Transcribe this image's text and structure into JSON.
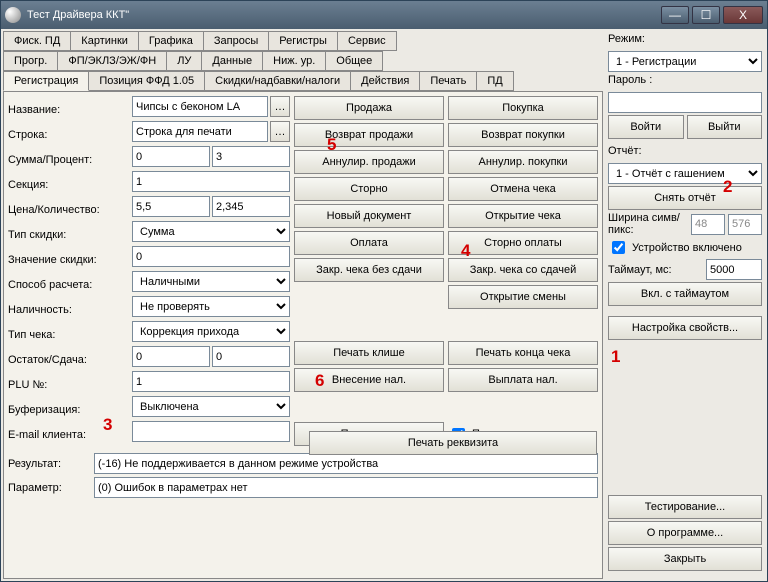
{
  "window": {
    "title": "Тест Драйвера ККТ\""
  },
  "winbtns": {
    "min": "—",
    "max": "☐",
    "close": "X"
  },
  "tabs_row1": [
    "Фиск. ПД",
    "Картинки",
    "Графика",
    "Запросы",
    "Регистры",
    "Сервис"
  ],
  "tabs_row2": [
    "Прогр.",
    "ФП/ЭКЛЗ/ЭЖ/ФН",
    "ЛУ",
    "Данные",
    "Ниж. ур.",
    "Общее"
  ],
  "tabs_row3": [
    "Регистрация",
    "Позиция ФФД 1.05",
    "Скидки/надбавки/налоги",
    "Действия",
    "Печать",
    "ПД"
  ],
  "labels": {
    "name": "Название:",
    "line": "Строка:",
    "sum_percent": "Сумма/Процент:",
    "section": "Секция:",
    "price_qty": "Цена/Количество:",
    "discount_type": "Тип скидки:",
    "discount_value": "Значение скидки:",
    "payment_method": "Способ расчета:",
    "cash": "Наличность:",
    "check_type": "Тип чека:",
    "balance_change": "Остаток/Сдача:",
    "plu": "PLU №:",
    "buffering": "Буферизация:",
    "email": "E-mail клиента:"
  },
  "values": {
    "name": "Чипсы с беконом LA",
    "line": "Строка для печати",
    "sum": "0",
    "percent": "3",
    "section": "1",
    "price": "5,5",
    "qty": "2,345",
    "discount_type": "Сумма",
    "discount_value": "0",
    "payment_method": "Наличными",
    "cash": "Не проверять",
    "check_type": "Коррекция прихода",
    "balance": "0",
    "change": "0",
    "plu": "1",
    "buffering": "Выключена",
    "email": ""
  },
  "btncol1": [
    "Продажа",
    "Возврат продажи",
    "Аннулир. продажи",
    "Сторно",
    "Новый документ",
    "Оплата",
    "Закр. чека без сдачи"
  ],
  "btncol2": [
    "Покупка",
    "Возврат покупки",
    "Аннулир. покупки",
    "Отмена чека",
    "Открытие чека",
    "Сторно оплаты",
    "Закр. чека со сдачей",
    "Открытие смены"
  ],
  "midbtns": {
    "print_requisite": "Печать реквизита",
    "print_cliche": "Печать клише",
    "print_end_check": "Печать конца чека",
    "cash_in": "Внесение нал.",
    "cash_out": "Выплата нал.",
    "apply": "Применить",
    "print_check": "Печатать чек"
  },
  "right": {
    "mode_lbl": "Режим:",
    "mode": "1 - Регистрации",
    "password_lbl": "Пароль :",
    "password": "",
    "login": "Войти",
    "logout": "Выйти",
    "report_lbl": "Отчёт:",
    "report": "1 - Отчёт с гашением",
    "take_report": "Снять отчёт",
    "width_lbl": "Ширина симв/пикс:",
    "width_chars": "48",
    "width_px": "576",
    "device_on": "Устройство включено",
    "timeout_lbl": "Таймаут, мс:",
    "timeout": "5000",
    "on_with_timeout": "Вкл. с таймаутом",
    "props": "Настройка свойств...",
    "testing": "Тестирование...",
    "about": "О программе...",
    "close": "Закрыть"
  },
  "result": {
    "lbl": "Результат:",
    "val": "(-16) Не поддерживается в данном режиме устройства"
  },
  "param": {
    "lbl": "Параметр:",
    "val": "(0) Ошибок в параметрах нет"
  },
  "anno": {
    "a1": "1",
    "a2": "2",
    "a3": "3",
    "a4": "4",
    "a5": "5",
    "a6": "6"
  }
}
